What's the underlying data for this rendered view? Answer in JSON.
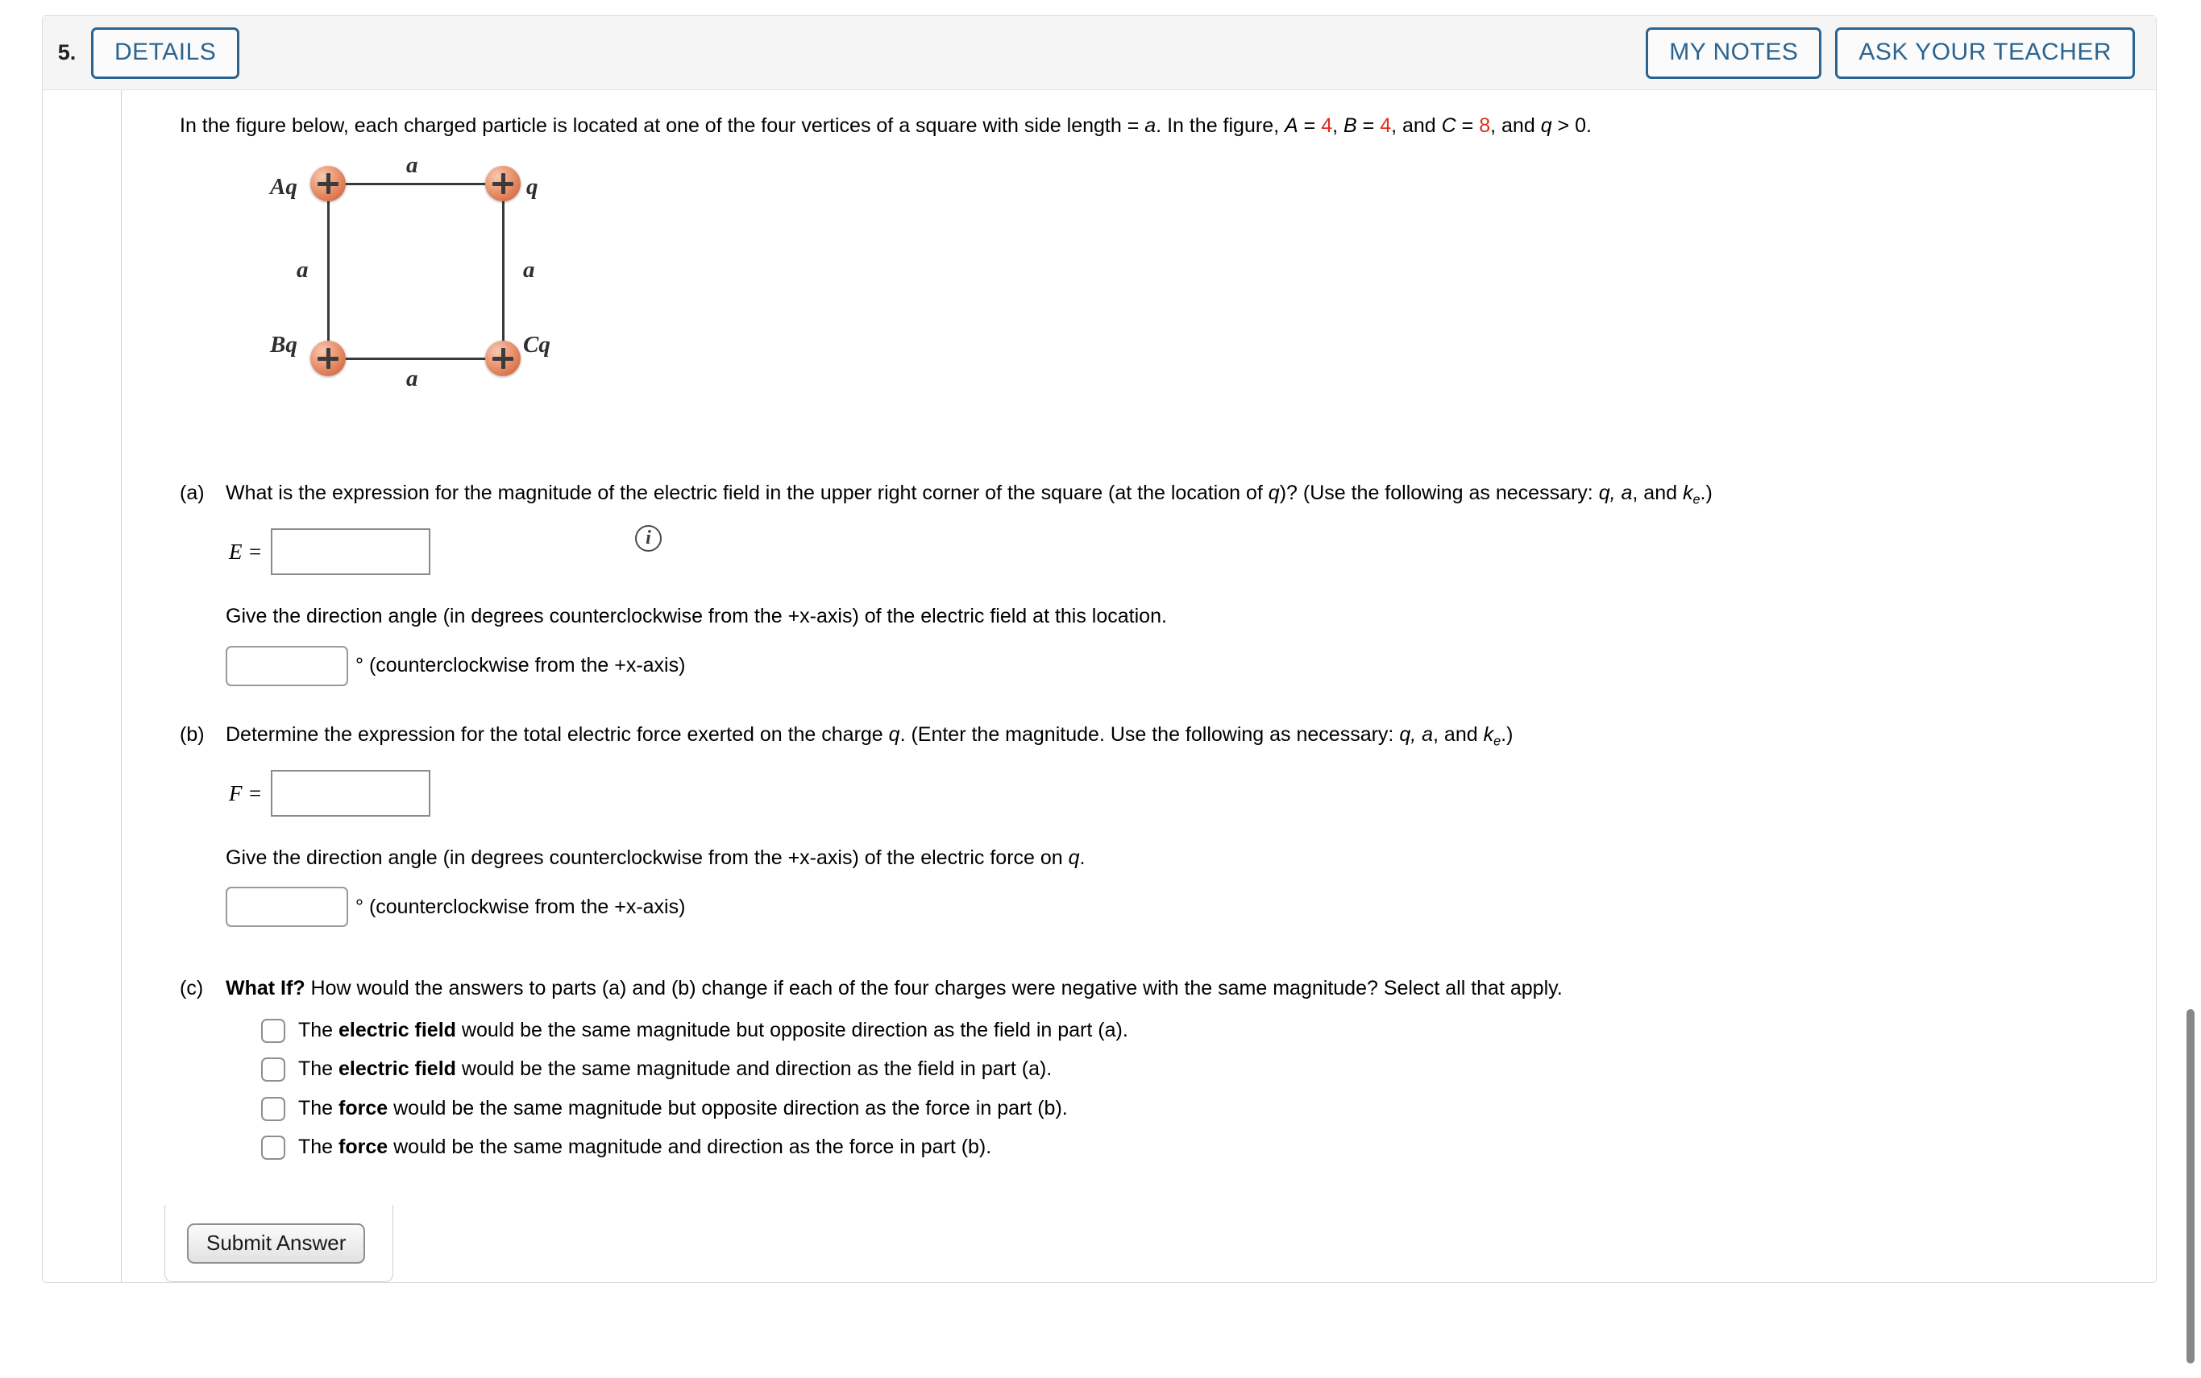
{
  "header": {
    "number": "5.",
    "details_label": "DETAILS",
    "my_notes_label": "MY NOTES",
    "ask_teacher_label": "ASK YOUR TEACHER"
  },
  "colors": {
    "accent_blue": "#2b6491",
    "value_red": "#e32a18",
    "charge_orange": "#ec9b79"
  },
  "intro": {
    "part1": "In the figure below, each charged particle is located at one of the four vertices of a square with side length = ",
    "a1": "a",
    "part2": ". In the figure, ",
    "A_symbol": "A",
    "eq1": " = ",
    "A_value": "4",
    "sep1": ", ",
    "B_symbol": "B",
    "eq2": " = ",
    "B_value": "4",
    "sep2": ", and ",
    "C_symbol": "C",
    "eq3": " = ",
    "C_value": "8",
    "tail": ", and ",
    "q_symbol": "q",
    "tail2": " > 0."
  },
  "figure": {
    "label_top_left": "Aq",
    "label_top_right": "q",
    "label_bottom_left": "Bq",
    "label_bottom_right": "Cq",
    "side_top": "a",
    "side_left": "a",
    "side_right": "a",
    "side_bottom": "a",
    "charge_sign": "+",
    "info_glyph": "i"
  },
  "parts": [
    {
      "label": "(a)",
      "prompt_1": "What is the expression for the magnitude of the electric field in the upper right corner of the square (at the location of ",
      "prompt_q": "q",
      "prompt_2": ")? (Use the following as necessary: ",
      "prompt_vars": "q, a",
      "prompt_3": ", and ",
      "prompt_k": "k",
      "prompt_k_sub": "e",
      "prompt_4": ".)",
      "answer_var": "E =",
      "answer_value": "",
      "answer_placeholder": "",
      "direction_prompt": "Give the direction angle (in degrees counterclockwise from the +x-axis) of the electric field at this location.",
      "angle_value": "",
      "angle_unit": "° (counterclockwise from the +x-axis)"
    },
    {
      "label": "(b)",
      "prompt_1": "Determine the expression for the total electric force exerted on the charge ",
      "prompt_q": "q",
      "prompt_2": ". (Enter the magnitude. Use the following as necessary: ",
      "prompt_vars": "q, a",
      "prompt_3": ", and ",
      "prompt_k": "k",
      "prompt_k_sub": "e",
      "prompt_4": ".)",
      "answer_var": "F =",
      "answer_value": "",
      "answer_placeholder": "",
      "direction_prompt_1": "Give the direction angle (in degrees counterclockwise from the +x-axis) of the electric force on ",
      "direction_prompt_q": "q",
      "direction_prompt_2": ".",
      "angle_value": "",
      "angle_unit": "° (counterclockwise from the +x-axis)"
    }
  ],
  "part_c": {
    "label": "(c)",
    "whatif": "What If?",
    "prompt": " How would the answers to parts (a) and (b) change if each of the four charges were negative with the same magnitude? Select all that apply.",
    "options": [
      {
        "pre": "The ",
        "bold": "electric field",
        "post": " would be the same magnitude but opposite direction as the field in part (a).",
        "checked": false
      },
      {
        "pre": "The ",
        "bold": "electric field",
        "post": " would be the same magnitude and direction as the field in part (a).",
        "checked": false
      },
      {
        "pre": "The ",
        "bold": "force",
        "post": " would be the same magnitude but opposite direction as the force in part (b).",
        "checked": false
      },
      {
        "pre": "The ",
        "bold": "force",
        "post": " would be the same magnitude and direction as the force in part (b).",
        "checked": false
      }
    ]
  },
  "footer": {
    "submit_label": "Submit Answer"
  }
}
